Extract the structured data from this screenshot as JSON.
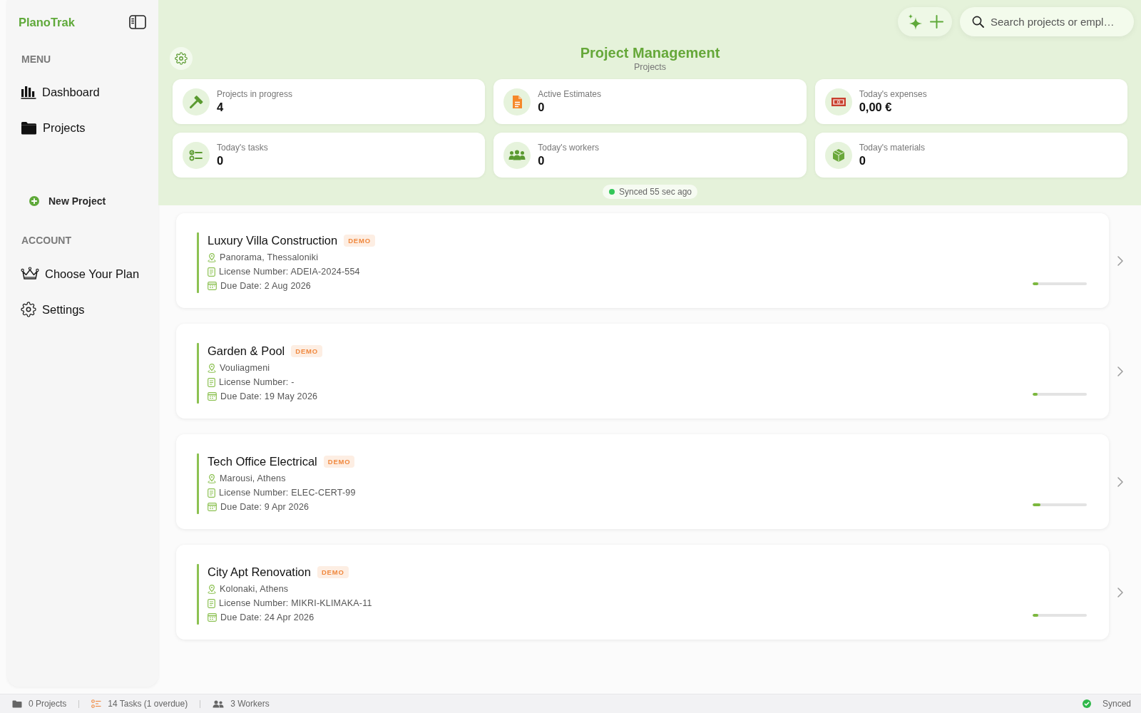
{
  "sidebar": {
    "brand": "PlanoTrak",
    "menu_heading": "MENU",
    "menu_items": [
      "Dashboard",
      "Projects"
    ],
    "new_project": "New Project",
    "account_heading": "ACCOUNT",
    "account_items": [
      "Choose Your Plan",
      "Settings"
    ]
  },
  "header": {
    "title": "Project Management",
    "subtitle": "Projects",
    "search": {
      "placeholder": "Search projects or empl…"
    },
    "sync_status": "Synced 55 sec ago"
  },
  "stats": [
    {
      "label": "Projects in progress",
      "value": "4"
    },
    {
      "label": "Active Estimates",
      "value": "0"
    },
    {
      "label": "Today's expenses",
      "value": "0,00 €"
    },
    {
      "label": "Today's tasks",
      "value": "0"
    },
    {
      "label": "Today's workers",
      "value": "0"
    },
    {
      "label": "Today's materials",
      "value": "0"
    }
  ],
  "projects": [
    {
      "name": "Luxury Villa Construction",
      "badge": "DEMO",
      "location": "Panorama, Thessaloniki",
      "license": "License Number: ADEIA-2024-554",
      "due": "Due Date: 2 Aug 2026",
      "level": 0.1
    },
    {
      "name": "Garden & Pool",
      "badge": "DEMO",
      "location": "Vouliagmeni",
      "license": "License Number: -",
      "due": "Due Date: 19 May 2026",
      "level": 0.09
    },
    {
      "name": "Tech Office Electrical",
      "badge": "DEMO",
      "location": "Marousi, Athens",
      "license": "License Number: ELEC-CERT-99",
      "due": "Due Date: 9 Apr 2026",
      "level": 0.15
    },
    {
      "name": "City Apt Renovation",
      "badge": "DEMO",
      "location": "Kolonaki, Athens",
      "license": "License Number: MIKRI-KLIMAKA-11",
      "due": "Due Date: 24 Apr 2026",
      "level": 0.1
    }
  ],
  "status_bar": {
    "items": [
      "0 Projects",
      "14 Tasks (1 overdue)",
      "3 Workers"
    ],
    "sync": "Synced"
  }
}
